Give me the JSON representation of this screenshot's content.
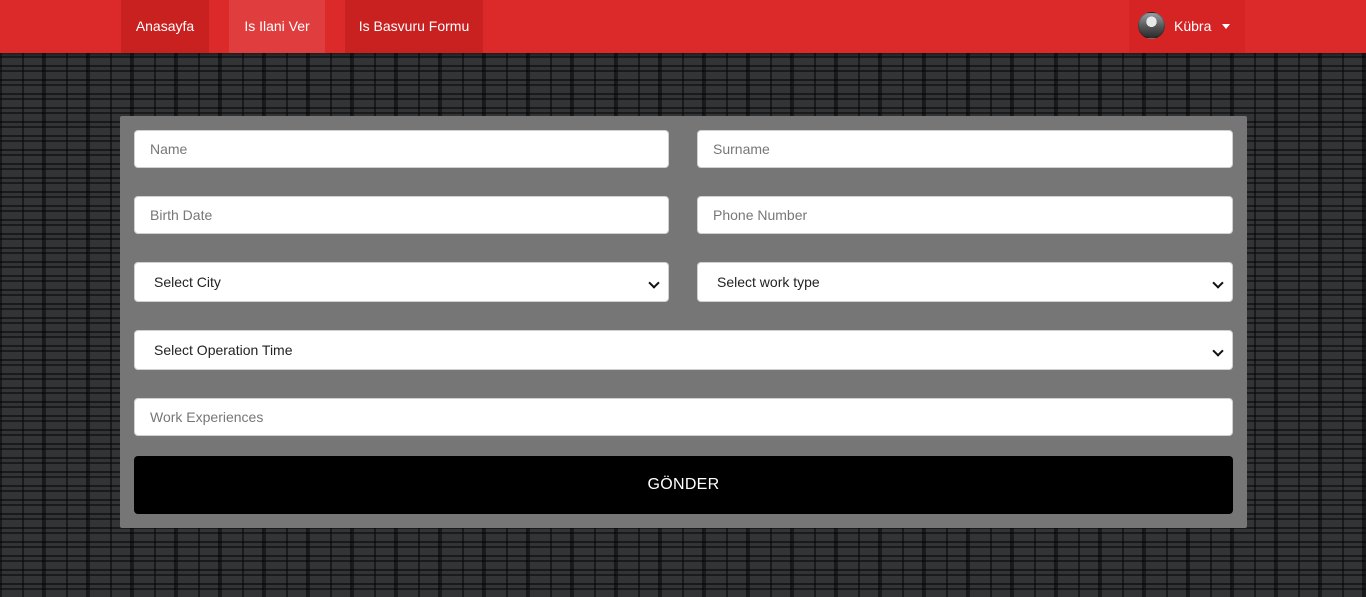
{
  "navbar": {
    "items": [
      {
        "label": "Anasayfa"
      },
      {
        "label": "Is Ilani Ver"
      },
      {
        "label": "Is Basvuru Formu"
      }
    ],
    "user": {
      "name": "Kübra",
      "avatar_icon": "user-avatar",
      "menu_icon": "caret-down-icon"
    },
    "colors": {
      "bar": "#dc2a2a",
      "active_item": "#e03e3e"
    }
  },
  "form": {
    "name": {
      "placeholder": "Name"
    },
    "surname": {
      "placeholder": "Surname"
    },
    "birth_date": {
      "placeholder": "Birth Date"
    },
    "phone": {
      "placeholder": "Phone Number"
    },
    "city_select": {
      "selected": "Select City"
    },
    "work_type_select": {
      "selected": "Select work type"
    },
    "operation_time_select": {
      "selected": "Select Operation Time"
    },
    "work_experiences": {
      "placeholder": "Work Experiences"
    },
    "submit_label": "GÖNDER",
    "colors": {
      "panel": "#767676",
      "submit": "#000000"
    }
  }
}
